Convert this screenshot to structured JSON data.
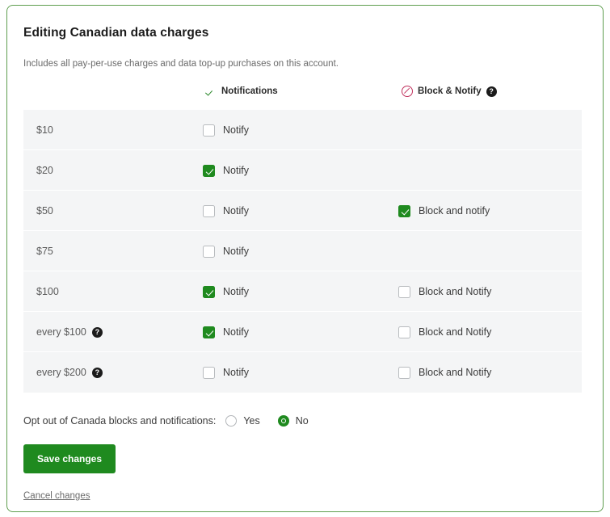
{
  "panel": {
    "title": "Editing Canadian data charges",
    "description": "Includes all pay-per-use charges and data top-up purchases on this account."
  },
  "columns": {
    "notifications": {
      "label": "Notifications",
      "icon": "check-icon",
      "icon_color": "#2f8a2f"
    },
    "block_notify": {
      "label": "Block & Notify",
      "icon": "block-circle-slash-icon",
      "icon_color": "#c0305c",
      "help_icon": "help-circle-icon",
      "help_glyph": "?"
    }
  },
  "rows": [
    {
      "amount": "$10",
      "has_help": false,
      "notify": {
        "label": "Notify",
        "checked": false
      },
      "block": {
        "label": "",
        "checked": false,
        "present": false
      }
    },
    {
      "amount": "$20",
      "has_help": false,
      "notify": {
        "label": "Notify",
        "checked": true
      },
      "block": {
        "label": "",
        "checked": false,
        "present": false
      }
    },
    {
      "amount": "$50",
      "has_help": false,
      "notify": {
        "label": "Notify",
        "checked": false
      },
      "block": {
        "label": "Block and notify",
        "checked": true,
        "present": true
      }
    },
    {
      "amount": "$75",
      "has_help": false,
      "notify": {
        "label": "Notify",
        "checked": false
      },
      "block": {
        "label": "",
        "checked": false,
        "present": false
      }
    },
    {
      "amount": "$100",
      "has_help": false,
      "notify": {
        "label": "Notify",
        "checked": true
      },
      "block": {
        "label": "Block and Notify",
        "checked": false,
        "present": true
      }
    },
    {
      "amount": "every $100",
      "has_help": true,
      "help_glyph": "?",
      "notify": {
        "label": "Notify",
        "checked": true
      },
      "block": {
        "label": "Block and Notify",
        "checked": false,
        "present": true
      }
    },
    {
      "amount": "every $200",
      "has_help": true,
      "help_glyph": "?",
      "notify": {
        "label": "Notify",
        "checked": false
      },
      "block": {
        "label": "Block and Notify",
        "checked": false,
        "present": true
      }
    }
  ],
  "optout": {
    "label": "Opt out of Canada blocks and notifications:",
    "options": [
      {
        "label": "Yes",
        "selected": false
      },
      {
        "label": "No",
        "selected": true
      }
    ]
  },
  "actions": {
    "save_label": "Save changes",
    "cancel_label": "Cancel changes"
  },
  "colors": {
    "brand_green": "#1f8a1f",
    "panel_border": "#5f9e4f",
    "row_background": "#f4f5f6",
    "block_red": "#c0305c"
  }
}
